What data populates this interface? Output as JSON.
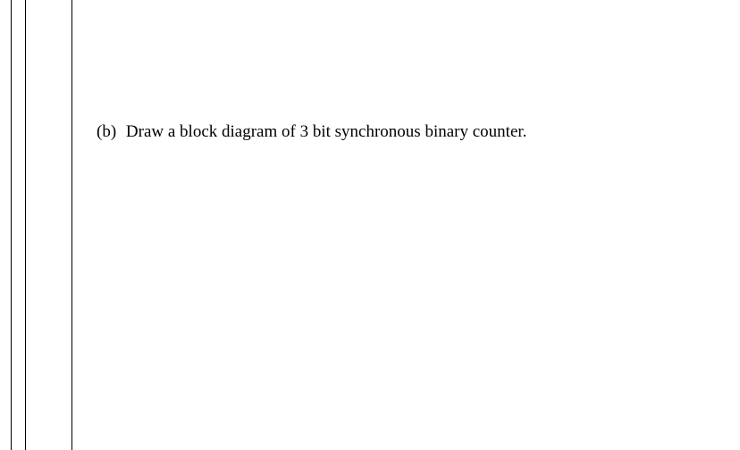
{
  "question": {
    "label": "(b)",
    "text": "Draw a block diagram of 3 bit synchronous binary counter."
  }
}
